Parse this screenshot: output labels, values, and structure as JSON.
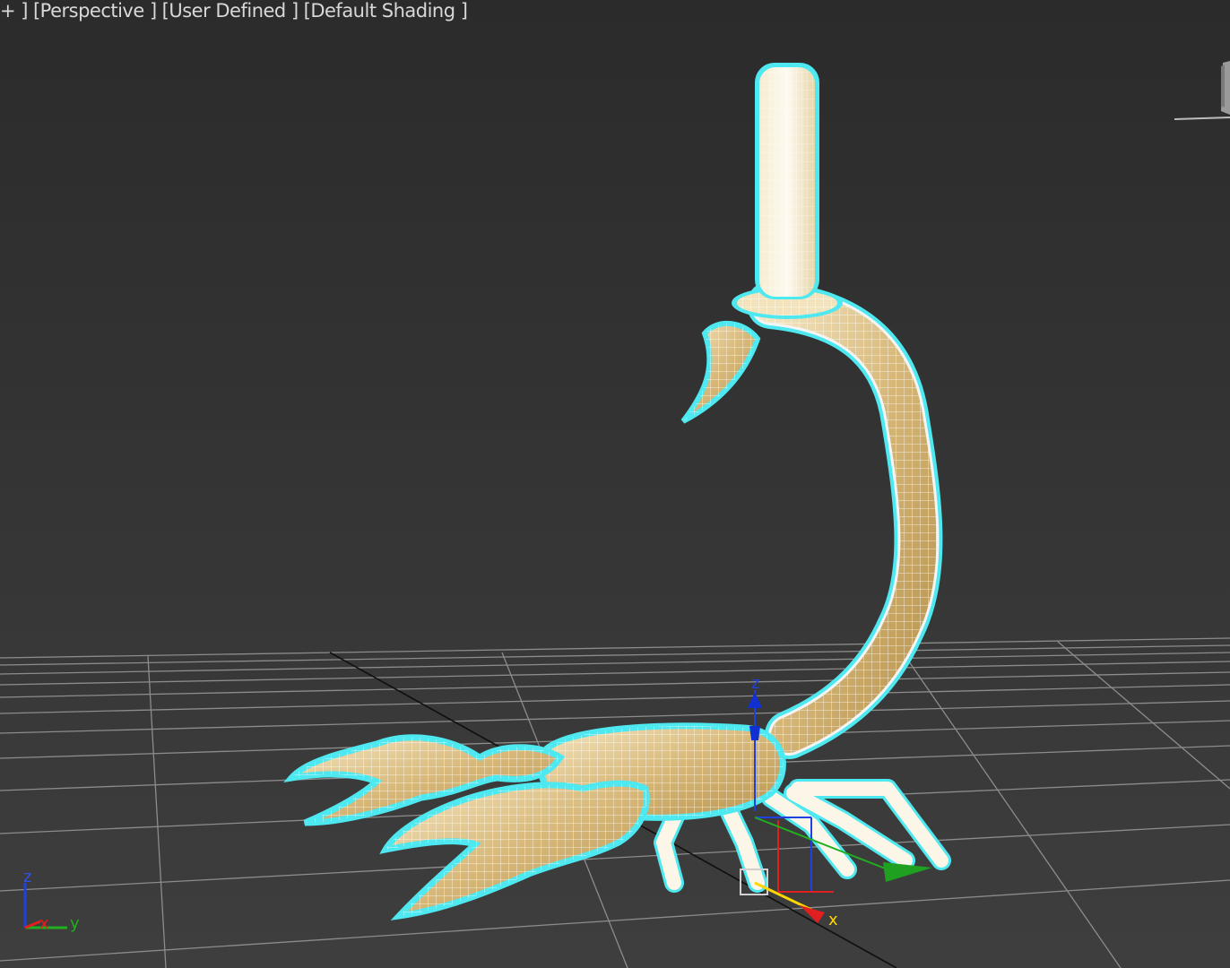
{
  "viewport": {
    "labels": {
      "menu": "+ ]",
      "view": "[Perspective ]",
      "mode": "[User Defined ]",
      "shading": "[Default Shading ]"
    }
  },
  "gizmo": {
    "z_label": "z",
    "x_label": "x"
  },
  "axis_tripod": {
    "z_label": "z",
    "x_label": "x",
    "y_label": "y"
  },
  "colors": {
    "background": "#2a2a2a",
    "selection_outline": "#4ee8f0",
    "model_fill": "#d9bb7a",
    "grid": "#8c8c8c",
    "axis_x": "#e02020",
    "axis_y": "#20b020",
    "axis_z": "#2040e0"
  },
  "icons": [
    "viewcube-icon",
    "move-gizmo-icon",
    "axis-tripod-icon"
  ]
}
